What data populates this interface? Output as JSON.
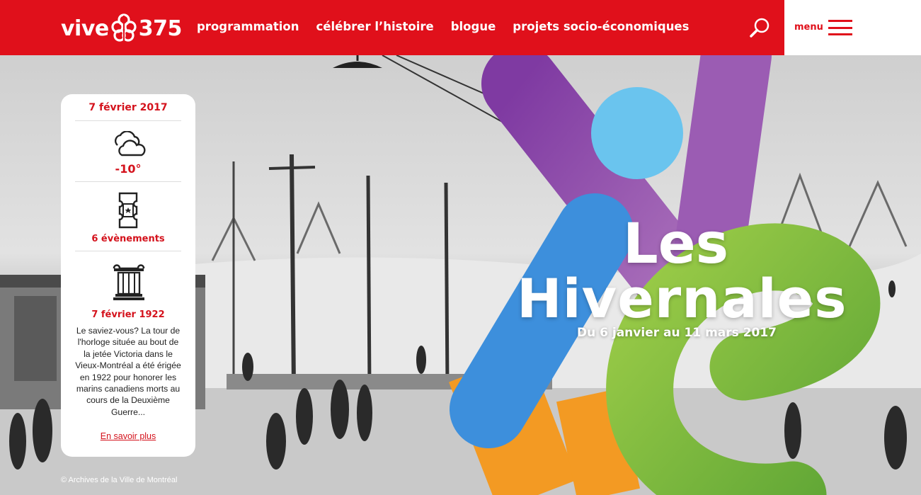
{
  "header": {
    "logo": {
      "left": "vive",
      "right": "375",
      "icon": "flower-logo-icon"
    },
    "nav": [
      "programmation",
      "célébrer l’histoire",
      "blogue",
      "projets socio-économiques"
    ],
    "search_icon": "search-icon",
    "menu_label": "menu",
    "menu_icon": "hamburger-icon",
    "brand_color": "#e0101b"
  },
  "hero": {
    "title_line1": "Les",
    "title_line2": "Hivernales",
    "dates": "Du 6 janvier au 11 mars 2017",
    "credit": "© Archives de la Ville de Montréal",
    "shape_colors": {
      "purple": "#8e44a8",
      "light_blue": "#6ac4ee",
      "blue": "#3d8fdc",
      "orange": "#f39a23",
      "green": "#7ab83a"
    }
  },
  "card": {
    "date": "7 février 2017",
    "weather_icon": "cloud-icon",
    "temperature": "-10°",
    "ticket_icon": "ticket-icon",
    "events": "6 évènements",
    "history_icon": "column-icon",
    "history_date": "7 février 1922",
    "history_text": "Le saviez-vous? La tour de l'horloge située au bout de la jetée Victoria dans le Vieux-Montréal a été érigée en 1922 pour honorer les marins canadiens morts au cours de la Deuxième Guerre...",
    "more_link": "En savoir plus"
  }
}
